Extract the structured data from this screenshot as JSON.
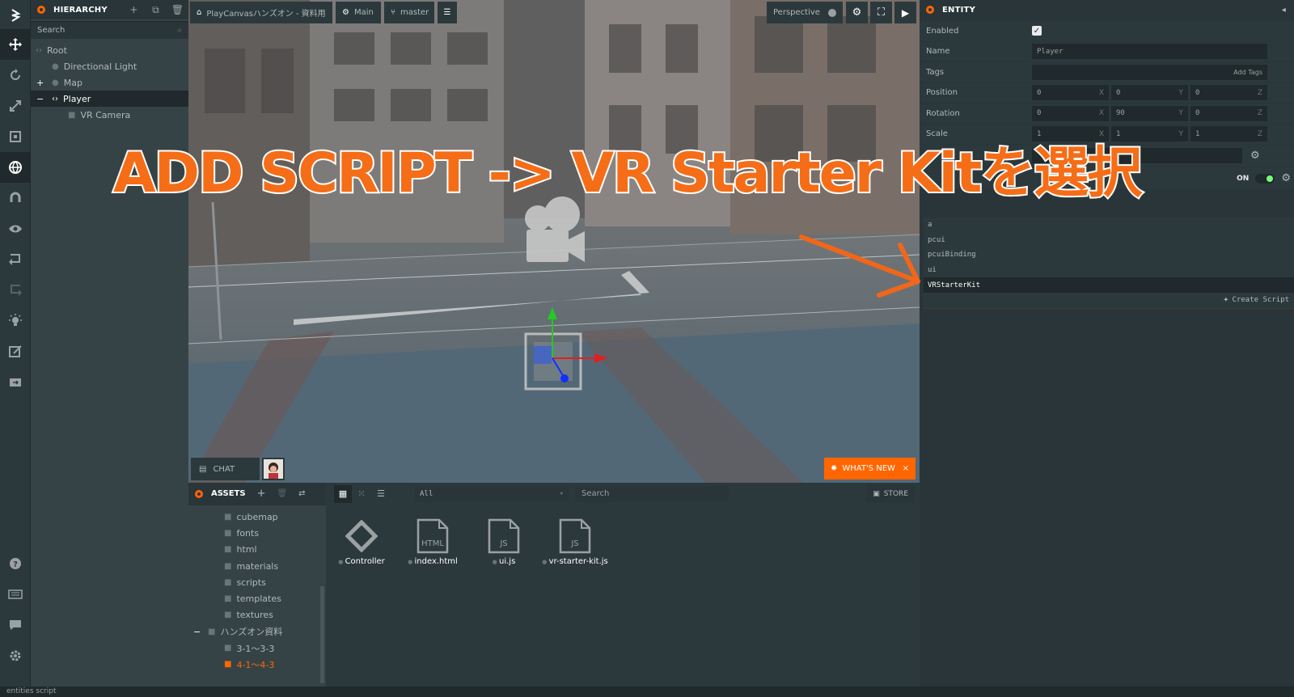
{
  "hierarchy": {
    "title": "HIERARCHY",
    "search_placeholder": "Search",
    "items": [
      {
        "label": "Root"
      },
      {
        "label": "Directional Light"
      },
      {
        "label": "Map"
      },
      {
        "label": "Player"
      },
      {
        "label": "VR Camera"
      }
    ]
  },
  "viewport": {
    "project": "PlayCanvasハンズオン - 資料用",
    "scene": "Main",
    "branch": "master",
    "camera_mode": "Perspective",
    "chat_label": "CHAT",
    "whats_new_label": "WHAT'S NEW",
    "whats_new_close": "×"
  },
  "assets": {
    "title": "ASSETS",
    "filter": "All",
    "search_placeholder": "Search",
    "store_label": "STORE",
    "folders": [
      {
        "label": "cubemap"
      },
      {
        "label": "fonts"
      },
      {
        "label": "html"
      },
      {
        "label": "materials"
      },
      {
        "label": "scripts"
      },
      {
        "label": "templates"
      },
      {
        "label": "textures"
      },
      {
        "label": "ハンズオン資料"
      },
      {
        "label": "3-1〜3-3"
      },
      {
        "label": "4-1〜4-3"
      }
    ],
    "files": [
      {
        "label": "Controller",
        "type": "template"
      },
      {
        "label": "index.html",
        "type": "HTML"
      },
      {
        "label": "ui.js",
        "type": "JS"
      },
      {
        "label": "vr-starter-kit.js",
        "type": "JS"
      }
    ]
  },
  "entity": {
    "title": "ENTITY",
    "enabled_label": "Enabled",
    "enabled": true,
    "name_label": "Name",
    "name_value": "Player",
    "tags_label": "Tags",
    "add_tags": "Add Tags",
    "position_label": "Position",
    "position": [
      "0",
      "0",
      "0"
    ],
    "rotation_label": "Rotation",
    "rotation": [
      "0",
      "90",
      "0"
    ],
    "scale_label": "Scale",
    "scale": [
      "1",
      "1",
      "1"
    ],
    "axes": [
      "X",
      "Y",
      "Z"
    ],
    "on_label": "ON",
    "script_options": [
      "a",
      "pcui",
      "pcuiBinding",
      "ui",
      "VRStarterKit"
    ],
    "create_script": "Create Script"
  },
  "overlay_text": "ADD SCRIPT -> VR Starter Kitを選択",
  "status_text": "entities script"
}
